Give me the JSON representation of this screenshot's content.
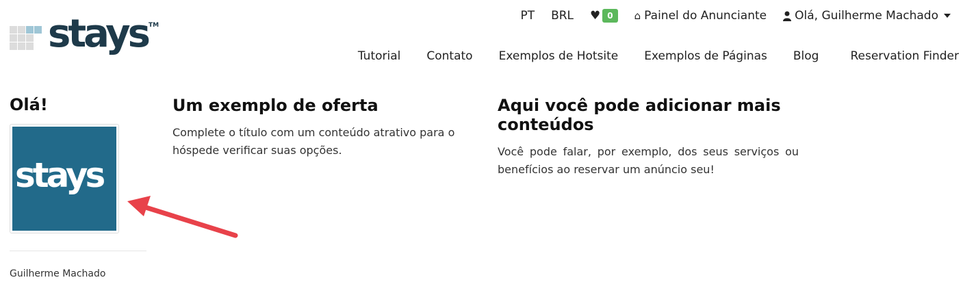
{
  "brand": {
    "logo_text": "stays",
    "trademark": "TM"
  },
  "topbar": {
    "language": "PT",
    "currency": "BRL",
    "favorites_count": "0",
    "host_panel": "Painel do Anunciante",
    "user_greeting": "Olá, Guilherme Machado"
  },
  "nav": {
    "items": [
      "Tutorial",
      "Contato",
      "Exemplos de Hotsite",
      "Exemplos de Páginas",
      "Blog",
      "Reservation Finder"
    ]
  },
  "sidebar": {
    "greeting": "Olá!",
    "avatar_text": "stays",
    "user_name": "Guilherme Machado"
  },
  "blocks": [
    {
      "title": "Um exemplo de oferta",
      "text": "Complete o título com um conteúdo atrativo para o hóspede verificar suas opções."
    },
    {
      "title": "Aqui você pode adicionar mais conteúdos",
      "text": "Você pode falar, por exemplo, dos seus serviços ou benefícios ao reservar um anúncio seu!"
    }
  ],
  "colors": {
    "brand_dark": "#1e3a4a",
    "avatar_bg": "#226a8a",
    "badge": "#5cb85c",
    "arrow": "#e8424a"
  },
  "icons": [
    "heart-icon",
    "home-icon",
    "user-icon",
    "caret-down-icon",
    "arrow-annotation"
  ]
}
